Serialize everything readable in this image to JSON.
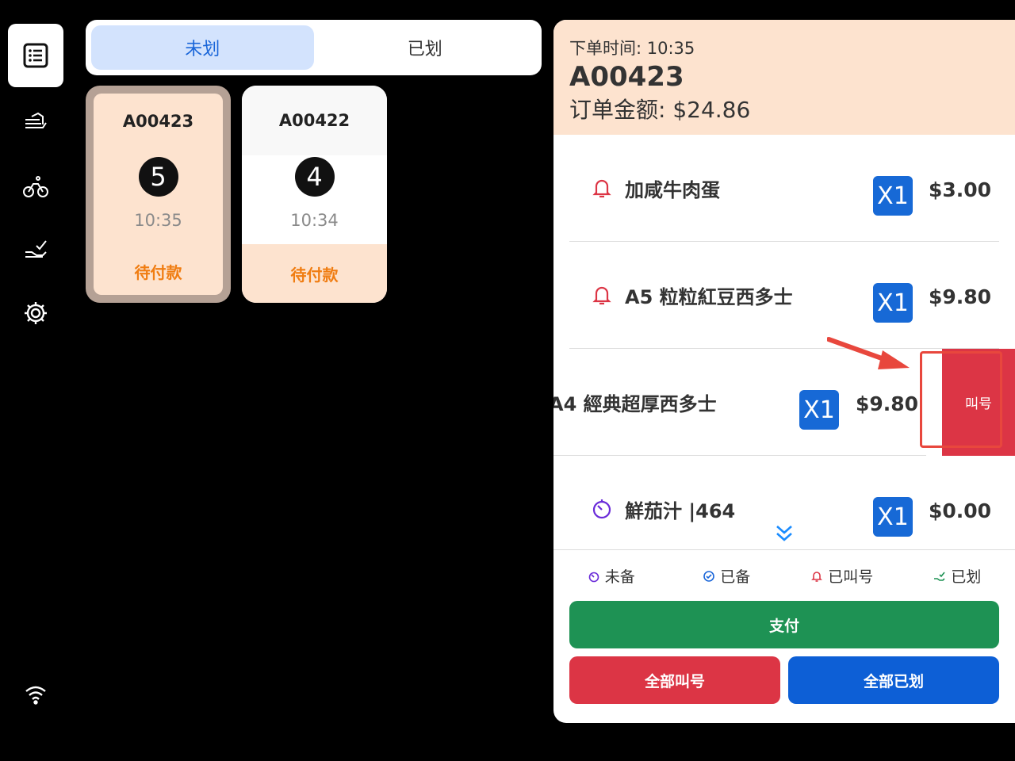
{
  "tabs": [
    {
      "label": "未划",
      "active": true
    },
    {
      "label": "已划",
      "active": false
    }
  ],
  "orders": [
    {
      "id": "A00423",
      "number": "5",
      "time": "10:35",
      "status": "待付款",
      "selected": true
    },
    {
      "id": "A00422",
      "number": "4",
      "time": "10:34",
      "status": "待付款",
      "selected": false
    }
  ],
  "detail": {
    "order_time": "下单时间: 10:35",
    "order_no": "A00423",
    "amount": "订单金额: $24.86",
    "items": [
      {
        "name": "加咸牛肉蛋",
        "qty": "X1",
        "price": "$3.00",
        "state": "called"
      },
      {
        "name": "A5 粒粒紅豆西多士",
        "qty": "X1",
        "price": "$9.80",
        "state": "called"
      },
      {
        "name": "A4 經典超厚西多士",
        "qty": "X1",
        "price": "$9.80",
        "state": "swiped"
      },
      {
        "name": "鮮茄汁 |464",
        "qty": "X1",
        "price": "$0.00",
        "state": "not-ready"
      }
    ],
    "swipe_action": "叫号"
  },
  "legend": [
    {
      "label": "未备",
      "icon": "timer-icon",
      "color": "#6a2bd9"
    },
    {
      "label": "已备",
      "icon": "check-circle-icon",
      "color": "#1a66d9"
    },
    {
      "label": "已叫号",
      "icon": "bell-icon",
      "color": "#dc3545"
    },
    {
      "label": "已划",
      "icon": "hand-check-icon",
      "color": "#1e9254"
    }
  ],
  "buttons": {
    "pay": "支付",
    "call_all": "全部叫号",
    "mark_all": "全部已划"
  },
  "colors": {
    "accent_blue": "#1769d6",
    "call_red": "#dc3545",
    "pay_green": "#1e9254",
    "card_peach": "#fde3cf",
    "status_orange": "#f07d12"
  }
}
